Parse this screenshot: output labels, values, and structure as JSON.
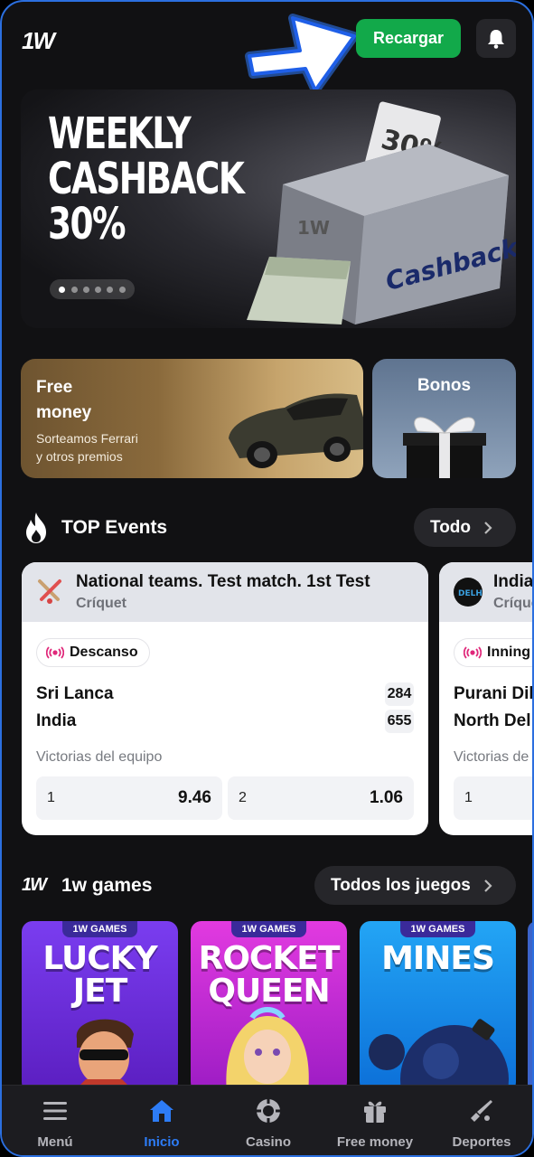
{
  "header": {
    "logo": "1W",
    "topup_label": "Recargar",
    "bell_icon": "bell-icon"
  },
  "banner": {
    "title": "WEEKLY\nCASHBACK\n30%",
    "slides_count": 6,
    "active_slide": 1
  },
  "promos": {
    "free_money": {
      "title": "Free\nmoney",
      "subtitle": "Sorteamos Ferrari\ny otros premios"
    },
    "bonos": {
      "title": "Bonos"
    }
  },
  "top_events": {
    "title": "TOP Events",
    "all_label": "Todo",
    "events": [
      {
        "league": "National teams. Test match. 1st Test",
        "sport": "Críquet",
        "status": "Descanso",
        "team1": "Sri Lanca",
        "score1": "284",
        "team2": "India",
        "score2": "655",
        "market": "Victorias del equipo",
        "odds": [
          {
            "k": "1",
            "v": "9.46"
          },
          {
            "k": "2",
            "v": "1.06"
          }
        ]
      },
      {
        "league": "India",
        "sport": "Críque",
        "status": "Inning",
        "team1": "Purani Dil",
        "team2": "North Del",
        "market": "Victorias de",
        "odds": [
          {
            "k": "1",
            "v": ""
          }
        ]
      }
    ]
  },
  "games": {
    "title": "1w games",
    "logo": "1W",
    "all_label": "Todos los juegos",
    "items": [
      {
        "tag": "1W GAMES",
        "name": "LUCKY\nJET"
      },
      {
        "tag": "1W GAMES",
        "name": "ROCKET\nQUEEN"
      },
      {
        "tag": "1W GAMES",
        "name": "MINES"
      }
    ]
  },
  "nav": {
    "items": [
      {
        "label": "Menú",
        "icon": "menu-icon"
      },
      {
        "label": "Inicio",
        "icon": "home-icon",
        "active": true
      },
      {
        "label": "Casino",
        "icon": "casino-chip-icon"
      },
      {
        "label": "Free money",
        "icon": "gift-icon"
      },
      {
        "label": "Deportes",
        "icon": "sports-icon"
      }
    ]
  },
  "colors": {
    "accent_green": "#12a94a",
    "active_blue": "#2d7cf6",
    "live_pink": "#e0287a"
  }
}
